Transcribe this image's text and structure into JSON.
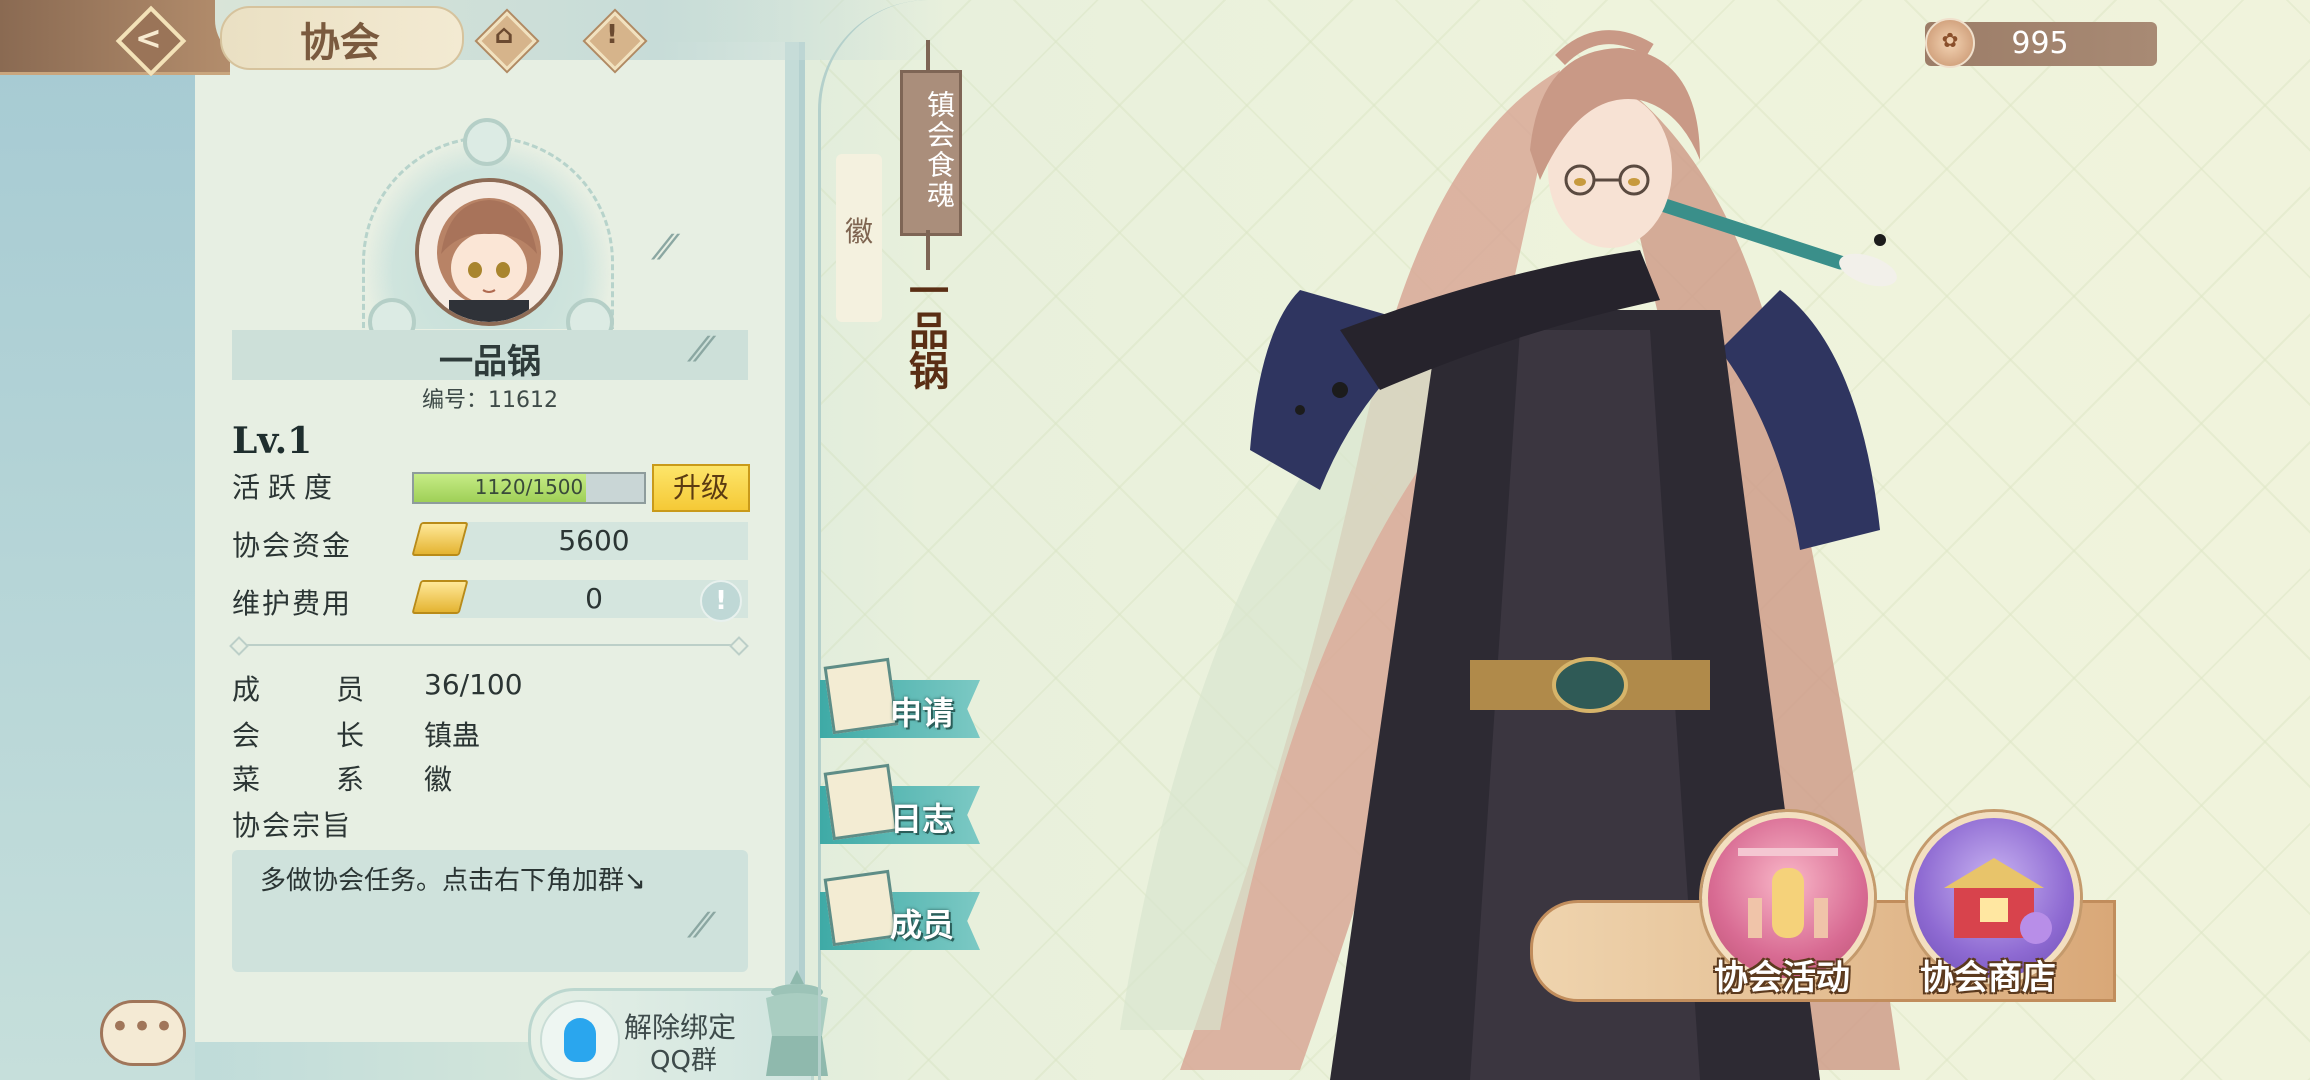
{
  "header": {
    "title": "协会",
    "back_icon": "back-arrow-icon",
    "crown_icon": "guild-hall-icon",
    "alert_glyph": "!"
  },
  "currency": {
    "icon": "coin-icon",
    "value": "995"
  },
  "guild": {
    "name": "一品锅",
    "id_label": "编号：11612",
    "level": "Lv.1",
    "activity_label": "活跃度",
    "activity_text": "1120/1500",
    "activity_fraction": 0.747,
    "upgrade_label": "升级",
    "funds_label": "协会资金",
    "funds_value": "5600",
    "upkeep_label": "维护费用",
    "upkeep_value": "0",
    "members_label": "成员",
    "members_value": "36/100",
    "leader_label": "会长",
    "leader_value": "镇蛊",
    "cuisine_label": "菜系",
    "cuisine_value": "徽",
    "motto_label": "协会宗旨",
    "motto_text": "多做协会任务。点击右下角加群↘"
  },
  "emblem": {
    "cuisine_char": "徽",
    "banner_text": "镇会食魂",
    "soul_name": "一品锅"
  },
  "side_buttons": [
    {
      "label": "申请",
      "icon": "application-icon"
    },
    {
      "label": "日志",
      "icon": "log-icon"
    },
    {
      "label": "成员",
      "icon": "members-icon"
    }
  ],
  "bottom": {
    "chat_glyph": "•••",
    "qq_line1": "解除绑定",
    "qq_line2": "QQ群",
    "activity_label": "协会活动",
    "shop_label": "协会商店"
  },
  "colors": {
    "accent_brown": "#8a6a52",
    "panel_bg": "#e7efe3",
    "teal": "#3eaaa6",
    "upgrade_yellow": "#f5c936"
  }
}
